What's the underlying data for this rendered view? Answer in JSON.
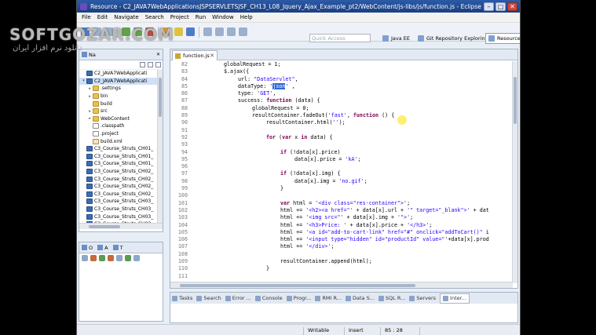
{
  "window": {
    "title": "Resource - C2_JAVA7WebApplicationsJSPSERVLETSJSF_CH13_L08_Jquery_Ajax_Example_pt2/WebContent/js-libs/js/function.js - Eclipse",
    "buttons": [
      "–",
      "□",
      "✕"
    ]
  },
  "menu": [
    "File",
    "Edit",
    "Navigate",
    "Search",
    "Project",
    "Run",
    "Window",
    "Help"
  ],
  "quick_access": {
    "placeholder": "Quick Access"
  },
  "perspectives": [
    {
      "label": "Java EE",
      "active": false
    },
    {
      "label": "Git Repository Exploring",
      "active": false
    },
    {
      "label": "Resource",
      "active": true
    }
  ],
  "left_panel": {
    "tab_label": "Na",
    "tree": [
      {
        "label": "C2_JAVA7WebApplicati",
        "depth": 0,
        "twisty": "",
        "icon": "proj"
      },
      {
        "label": "C2_JAVA7WebApplicati",
        "depth": 0,
        "twisty": "▾",
        "icon": "proj",
        "selected": true
      },
      {
        "label": ".settings",
        "depth": 1,
        "twisty": "▸",
        "icon": "fold"
      },
      {
        "label": "bin",
        "depth": 1,
        "twisty": "▸",
        "icon": "fold"
      },
      {
        "label": "build",
        "depth": 1,
        "twisty": "",
        "icon": "fold"
      },
      {
        "label": "src",
        "depth": 1,
        "twisty": "▸",
        "icon": "fold"
      },
      {
        "label": "WebContent",
        "depth": 1,
        "twisty": "▸",
        "icon": "fold"
      },
      {
        "label": ".classpath",
        "depth": 1,
        "twisty": "",
        "icon": "file"
      },
      {
        "label": ".project",
        "depth": 1,
        "twisty": "",
        "icon": "file"
      },
      {
        "label": "build.xml",
        "depth": 1,
        "twisty": "",
        "icon": "xml"
      },
      {
        "label": "C3_Course_Struts_CH01_",
        "depth": 0,
        "twisty": "",
        "icon": "proj"
      },
      {
        "label": "C3_Course_Struts_CH01_",
        "depth": 0,
        "twisty": "",
        "icon": "proj"
      },
      {
        "label": "C3_Course_Struts_CH01_",
        "depth": 0,
        "twisty": "",
        "icon": "proj"
      },
      {
        "label": "C3_Course_Struts_CH02_",
        "depth": 0,
        "twisty": "",
        "icon": "proj"
      },
      {
        "label": "C3_Course_Struts_CH02_",
        "depth": 0,
        "twisty": "",
        "icon": "proj"
      },
      {
        "label": "C3_Course_Struts_CH02_",
        "depth": 0,
        "twisty": "",
        "icon": "proj"
      },
      {
        "label": "C3_Course_Struts_CH02_",
        "depth": 0,
        "twisty": "",
        "icon": "proj"
      },
      {
        "label": "C3_Course_Struts_CH03_",
        "depth": 0,
        "twisty": "",
        "icon": "proj"
      },
      {
        "label": "C3_Course_Struts_CH03_",
        "depth": 0,
        "twisty": "",
        "icon": "proj"
      },
      {
        "label": "C3_Course_Struts_CH03_",
        "depth": 0,
        "twisty": "",
        "icon": "proj"
      },
      {
        "label": "C3_Course_Struts_CH03_",
        "depth": 0,
        "twisty": "",
        "icon": "proj"
      }
    ]
  },
  "outline_panel": {
    "tabs": [
      "O",
      "A",
      "T"
    ]
  },
  "editor": {
    "tab_label": "function.js",
    "lines": [
      {
        "n": "82",
        "i": 2,
        "parts": [
          {
            "t": "globalRequest = 1;"
          }
        ]
      },
      {
        "n": "83",
        "i": 2,
        "parts": [
          {
            "t": "$.ajax({"
          }
        ]
      },
      {
        "n": "84",
        "i": 4,
        "parts": [
          {
            "t": "url: "
          },
          {
            "t": "\"DataServlet\"",
            "c": "str"
          },
          {
            "t": ","
          }
        ]
      },
      {
        "n": "85",
        "i": 4,
        "parts": [
          {
            "t": "dataType: "
          },
          {
            "t": "'"
          },
          {
            "t": "json",
            "c": "hl-sel"
          },
          {
            "t": "' ,"
          }
        ]
      },
      {
        "n": "86",
        "i": 4,
        "parts": [
          {
            "t": "type: "
          },
          {
            "t": "'GET'",
            "c": "str"
          },
          {
            "t": ","
          }
        ]
      },
      {
        "n": "87",
        "i": 4,
        "parts": [
          {
            "t": "success: "
          },
          {
            "t": "function",
            "c": "kw"
          },
          {
            "t": " (data) {"
          }
        ]
      },
      {
        "n": "88",
        "i": 6,
        "parts": [
          {
            "t": "globalRequest = 0;"
          }
        ]
      },
      {
        "n": "89",
        "i": 6,
        "parts": [
          {
            "t": "resultContainer.fadeOut("
          },
          {
            "t": "'fast'",
            "c": "str"
          },
          {
            "t": ", "
          },
          {
            "t": "function",
            "c": "kw"
          },
          {
            "t": " () {"
          }
        ]
      },
      {
        "n": "90",
        "i": 8,
        "parts": [
          {
            "t": "resultContainer.html("
          },
          {
            "t": "''",
            "c": "str"
          },
          {
            "t": ");"
          }
        ]
      },
      {
        "n": "91",
        "i": 0,
        "parts": []
      },
      {
        "n": "92",
        "i": 8,
        "parts": [
          {
            "t": "for",
            "c": "kw"
          },
          {
            "t": " ("
          },
          {
            "t": "var",
            "c": "kw"
          },
          {
            "t": " x "
          },
          {
            "t": "in",
            "c": "kw"
          },
          {
            "t": " data) {"
          }
        ]
      },
      {
        "n": "93",
        "i": 0,
        "parts": []
      },
      {
        "n": "94",
        "i": 10,
        "parts": [
          {
            "t": "if",
            "c": "kw"
          },
          {
            "t": " (!data[x].price)"
          }
        ]
      },
      {
        "n": "95",
        "i": 12,
        "parts": [
          {
            "t": "data[x].price = "
          },
          {
            "t": "'kA'",
            "c": "str"
          },
          {
            "t": ";"
          }
        ]
      },
      {
        "n": "96",
        "i": 0,
        "parts": []
      },
      {
        "n": "97",
        "i": 10,
        "parts": [
          {
            "t": "if",
            "c": "kw"
          },
          {
            "t": " (!data[x].img) {"
          }
        ]
      },
      {
        "n": "98",
        "i": 12,
        "parts": [
          {
            "t": "data[x].img = "
          },
          {
            "t": "'no.gif'",
            "c": "str"
          },
          {
            "t": ";"
          }
        ]
      },
      {
        "n": "99",
        "i": 10,
        "parts": [
          {
            "t": "}"
          }
        ]
      },
      {
        "n": "100",
        "i": 0,
        "parts": []
      },
      {
        "n": "101",
        "i": 10,
        "parts": [
          {
            "t": "var",
            "c": "kw"
          },
          {
            "t": " html = "
          },
          {
            "t": "'<div class=\"res-container\">'",
            "c": "str"
          },
          {
            "t": ";"
          }
        ]
      },
      {
        "n": "102",
        "i": 10,
        "parts": [
          {
            "t": "html += "
          },
          {
            "t": "'<h2><a href=\"'",
            "c": "str"
          },
          {
            "t": " + data[x].url + "
          },
          {
            "t": "'\" target=\"_blank\">'",
            "c": "str"
          },
          {
            "t": " + dat"
          }
        ]
      },
      {
        "n": "103",
        "i": 10,
        "parts": [
          {
            "t": "html += "
          },
          {
            "t": "'<img src=\"'",
            "c": "str"
          },
          {
            "t": " + data[x].img + "
          },
          {
            "t": "'\">'",
            "c": "str"
          },
          {
            "t": ";"
          }
        ]
      },
      {
        "n": "104",
        "i": 10,
        "parts": [
          {
            "t": "html += "
          },
          {
            "t": "'<h3>Price: '",
            "c": "str"
          },
          {
            "t": " + data[x].price + "
          },
          {
            "t": "'</h3>'",
            "c": "str"
          },
          {
            "t": ";"
          }
        ]
      },
      {
        "n": "105",
        "i": 10,
        "parts": [
          {
            "t": "html += "
          },
          {
            "t": "'<a id=\"add-to-cart-link\" href=\"#\" onclick=\"addToCart()\"",
            "c": "str"
          },
          {
            "t": " i"
          }
        ]
      },
      {
        "n": "106",
        "i": 10,
        "parts": [
          {
            "t": "html += "
          },
          {
            "t": "'<input type=\"hidden\" id=\"productId\" value=\"'",
            "c": "str"
          },
          {
            "t": "+data[x].prod"
          }
        ]
      },
      {
        "n": "107",
        "i": 10,
        "parts": [
          {
            "t": "html += "
          },
          {
            "t": "'</div>'",
            "c": "str"
          },
          {
            "t": ";"
          }
        ]
      },
      {
        "n": "108",
        "i": 0,
        "parts": []
      },
      {
        "n": "109",
        "i": 10,
        "parts": [
          {
            "t": "resultContainer.append(html);"
          }
        ]
      },
      {
        "n": "110",
        "i": 8,
        "parts": [
          {
            "t": "}"
          }
        ]
      },
      {
        "n": "111",
        "i": 0,
        "parts": []
      }
    ]
  },
  "bottom_panel": {
    "tabs": [
      "Tasks",
      "Search",
      "Error ...",
      "Console",
      "Progr...",
      "RMI R...",
      "Data S...",
      "SQL R...",
      "Servers",
      "Inter..."
    ],
    "active_tab": 9
  },
  "status_bar": {
    "writable": "Writable",
    "insert": "Insert",
    "position": "85 : 28"
  },
  "watermark": {
    "text": "SOFTGOZAR.COM",
    "subtitle": "دانلود نرم افزار ایران"
  }
}
